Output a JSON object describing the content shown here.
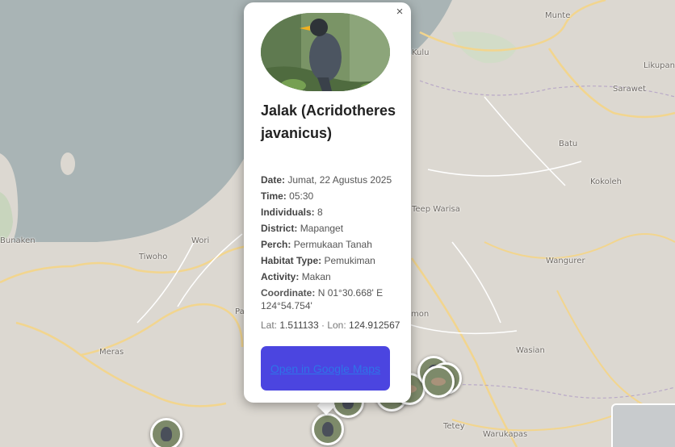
{
  "map": {
    "places": [
      {
        "key": "munte",
        "name": "Munte"
      },
      {
        "key": "likupang",
        "name": "Likupan"
      },
      {
        "key": "kulu",
        "name": "Kulu"
      },
      {
        "key": "sarawet",
        "name": "Sarawet"
      },
      {
        "key": "batu",
        "name": "Batu"
      },
      {
        "key": "kokoleh",
        "name": "Kokoleh"
      },
      {
        "key": "teep",
        "name": "Teep Warisa"
      },
      {
        "key": "bunaken",
        "name": "Bunaken"
      },
      {
        "key": "wori",
        "name": "Wori"
      },
      {
        "key": "tiwoho",
        "name": "Tiwoho"
      },
      {
        "key": "wangurer",
        "name": "Wangurer"
      },
      {
        "key": "meras",
        "name": "Meras"
      },
      {
        "key": "wasian",
        "name": "Wasian"
      },
      {
        "key": "tetey",
        "name": "Tetey"
      },
      {
        "key": "warukapas",
        "name": "Warukapas"
      },
      {
        "key": "mon",
        "name": "mon"
      },
      {
        "key": "pa",
        "name": "Pa"
      }
    ]
  },
  "popup": {
    "close_icon": "×",
    "species": "Jalak (Acridotheres javanicus)",
    "fields": [
      {
        "label": "Date:",
        "value": "Jumat, 22 Agustus 2025"
      },
      {
        "label": "Time:",
        "value": "05:30"
      },
      {
        "label": "Individuals:",
        "value": "8"
      },
      {
        "label": "District:",
        "value": "Mapanget"
      },
      {
        "label": "Perch:",
        "value": "Permukaan Tanah"
      },
      {
        "label": "Habitat Type:",
        "value": "Pemukiman"
      },
      {
        "label": "Activity:",
        "value": "Makan"
      }
    ],
    "coordinate": {
      "label": "Coordinate:",
      "value": "N 01°30.668' E 124°54.754'"
    },
    "latlon": {
      "lat_label": "Lat:",
      "lat": "1.511133",
      "sep": "·",
      "lon_label": "Lon:",
      "lon": "124.912567"
    },
    "cta_label": "Open in Google Maps"
  }
}
